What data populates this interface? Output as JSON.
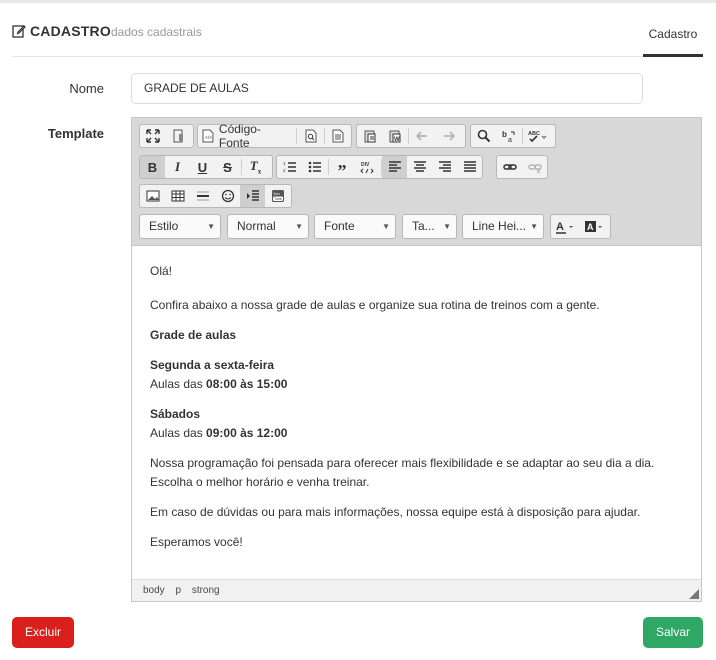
{
  "header": {
    "title": "CADASTRO",
    "subtitle": "dados cadastrais",
    "tab": "Cadastro"
  },
  "form": {
    "nome_label": "Nome",
    "nome_value": "GRADE DE AULAS",
    "template_label": "Template"
  },
  "toolbar": {
    "source_label": "Código-Fonte",
    "combos": {
      "style": "Estilo",
      "format": "Normal",
      "font": "Fonte",
      "size": "Ta...",
      "line_height": "Line Hei..."
    },
    "icons": [
      "maximize-icon",
      "show-blocks-icon",
      "source-icon",
      "preview-icon",
      "templates-icon",
      "paste-text-icon",
      "paste-word-icon",
      "undo-icon",
      "redo-icon",
      "find-icon",
      "replace-icon",
      "spellcheck-icon",
      "bold-icon",
      "italic-icon",
      "underline-icon",
      "strikethrough-icon",
      "remove-format-icon",
      "numbered-list-icon",
      "bulleted-list-icon",
      "blockquote-icon",
      "div-icon",
      "align-left-icon",
      "align-center-icon",
      "align-right-icon",
      "justify-icon",
      "link-icon",
      "unlink-icon",
      "image-icon",
      "table-icon",
      "horizontal-rule-icon",
      "smiley-icon",
      "indent-icon",
      "youtube-icon",
      "text-color-icon",
      "background-color-icon"
    ]
  },
  "content": {
    "greeting": "Olá!",
    "intro": "Confira abaixo a nossa grade de aulas e organize sua rotina de treinos com a gente.",
    "heading": "Grade de aulas",
    "weekdays_title": "Segunda a sexta-feira",
    "weekdays_prefix": "Aulas das",
    "weekdays_hours": "08:00 às 15:00",
    "saturday_title": "Sábados",
    "saturday_prefix": "Aulas das",
    "saturday_hours": "09:00 às 12:00",
    "program_line1": "Nossa programação foi pensada para oferecer mais flexibilidade e se adaptar ao seu dia a dia.",
    "program_line2": "Escolha o melhor horário e venha treinar.",
    "doubts": "Em caso de dúvidas ou para mais informações, nossa equipe está à disposição para ajudar.",
    "closing": "Esperamos você!"
  },
  "statusbar": {
    "path": [
      "body",
      "p",
      "strong"
    ]
  },
  "actions": {
    "delete_label": "Excluir",
    "save_label": "Salvar"
  },
  "colors": {
    "delete": "#d9201d",
    "save": "#2ea864",
    "toolbar_bg": "#d8d8d8"
  }
}
